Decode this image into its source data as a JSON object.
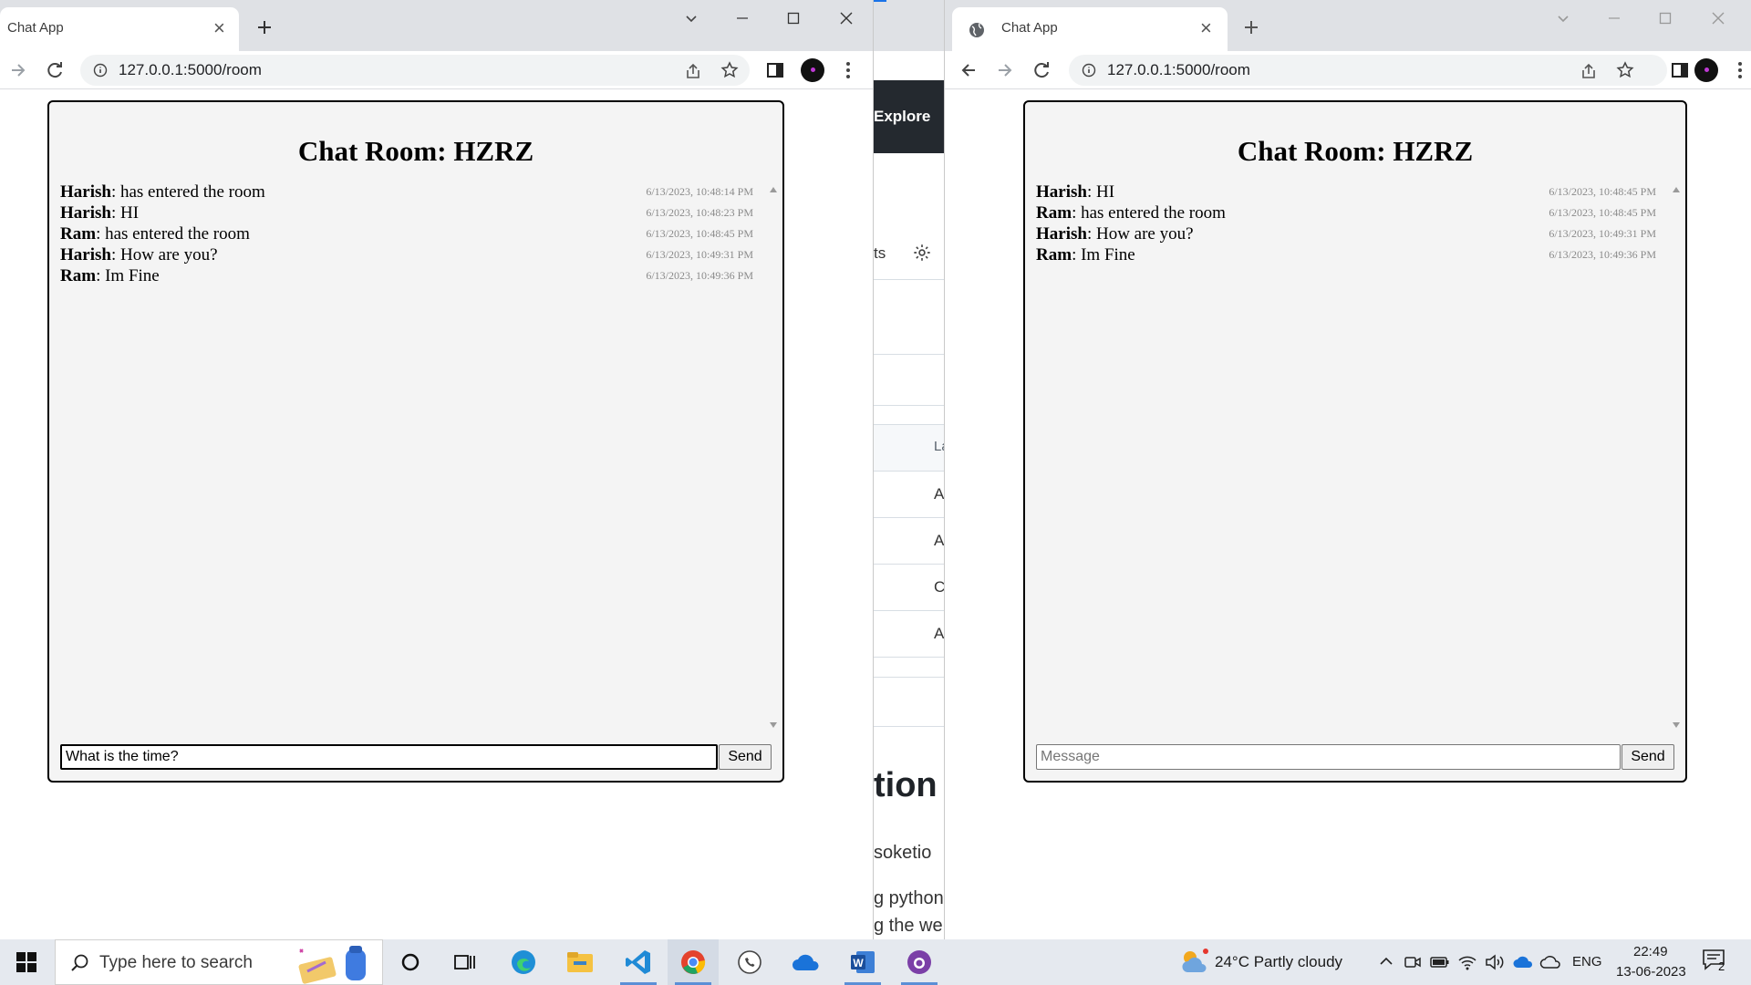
{
  "left_window": {
    "tab_title": "Chat App",
    "url": "127.0.0.1:5000/room",
    "chat": {
      "title": "Chat Room: HZRZ",
      "messages": [
        {
          "sender": "Harish",
          "text": ": has entered the room",
          "time": "6/13/2023, 10:48:14 PM"
        },
        {
          "sender": "Harish",
          "text": ": HI",
          "time": "6/13/2023, 10:48:23 PM"
        },
        {
          "sender": "Ram",
          "text": ": has entered the room",
          "time": "6/13/2023, 10:48:45 PM"
        },
        {
          "sender": "Harish",
          "text": ": How are you?",
          "time": "6/13/2023, 10:49:31 PM"
        },
        {
          "sender": "Ram",
          "text": ": Im Fine",
          "time": "6/13/2023, 10:49:36 PM"
        }
      ],
      "input_value": "What is the time?",
      "send_label": "Send"
    }
  },
  "middle_window": {
    "explore_label": "Explore",
    "snippets": [
      "ts",
      "La",
      "A",
      "A",
      "C",
      "A",
      "tion",
      "soketio",
      "g python",
      "g the we"
    ]
  },
  "right_window": {
    "tab_title": "Chat App",
    "url": "127.0.0.1:5000/room",
    "chat": {
      "title": "Chat Room: HZRZ",
      "messages": [
        {
          "sender": "Harish",
          "text": ": HI",
          "time": "6/13/2023, 10:48:45 PM"
        },
        {
          "sender": "Ram",
          "text": ": has entered the room",
          "time": "6/13/2023, 10:48:45 PM"
        },
        {
          "sender": "Harish",
          "text": ": How are you?",
          "time": "6/13/2023, 10:49:31 PM"
        },
        {
          "sender": "Ram",
          "text": ": Im Fine",
          "time": "6/13/2023, 10:49:36 PM"
        }
      ],
      "input_placeholder": "Message",
      "send_label": "Send"
    }
  },
  "taskbar": {
    "search_placeholder": "Type here to search",
    "apps": [
      "explorer-icon",
      "edge-icon",
      "file-explorer-icon",
      "vscode-icon",
      "chrome-icon",
      "whatsapp-icon",
      "onedrive-icon",
      "word-icon",
      "github-desktop-icon"
    ],
    "weather": "24°C  Partly cloudy",
    "language": "ENG",
    "time": "22:49",
    "date": "13-06-2023",
    "notification_count": "2"
  },
  "colors": {
    "taskbar": "#e5e9ef",
    "tabstrip": "#dfe1e5",
    "card_bg": "#f4f4f4",
    "github_dark": "#24292f"
  }
}
